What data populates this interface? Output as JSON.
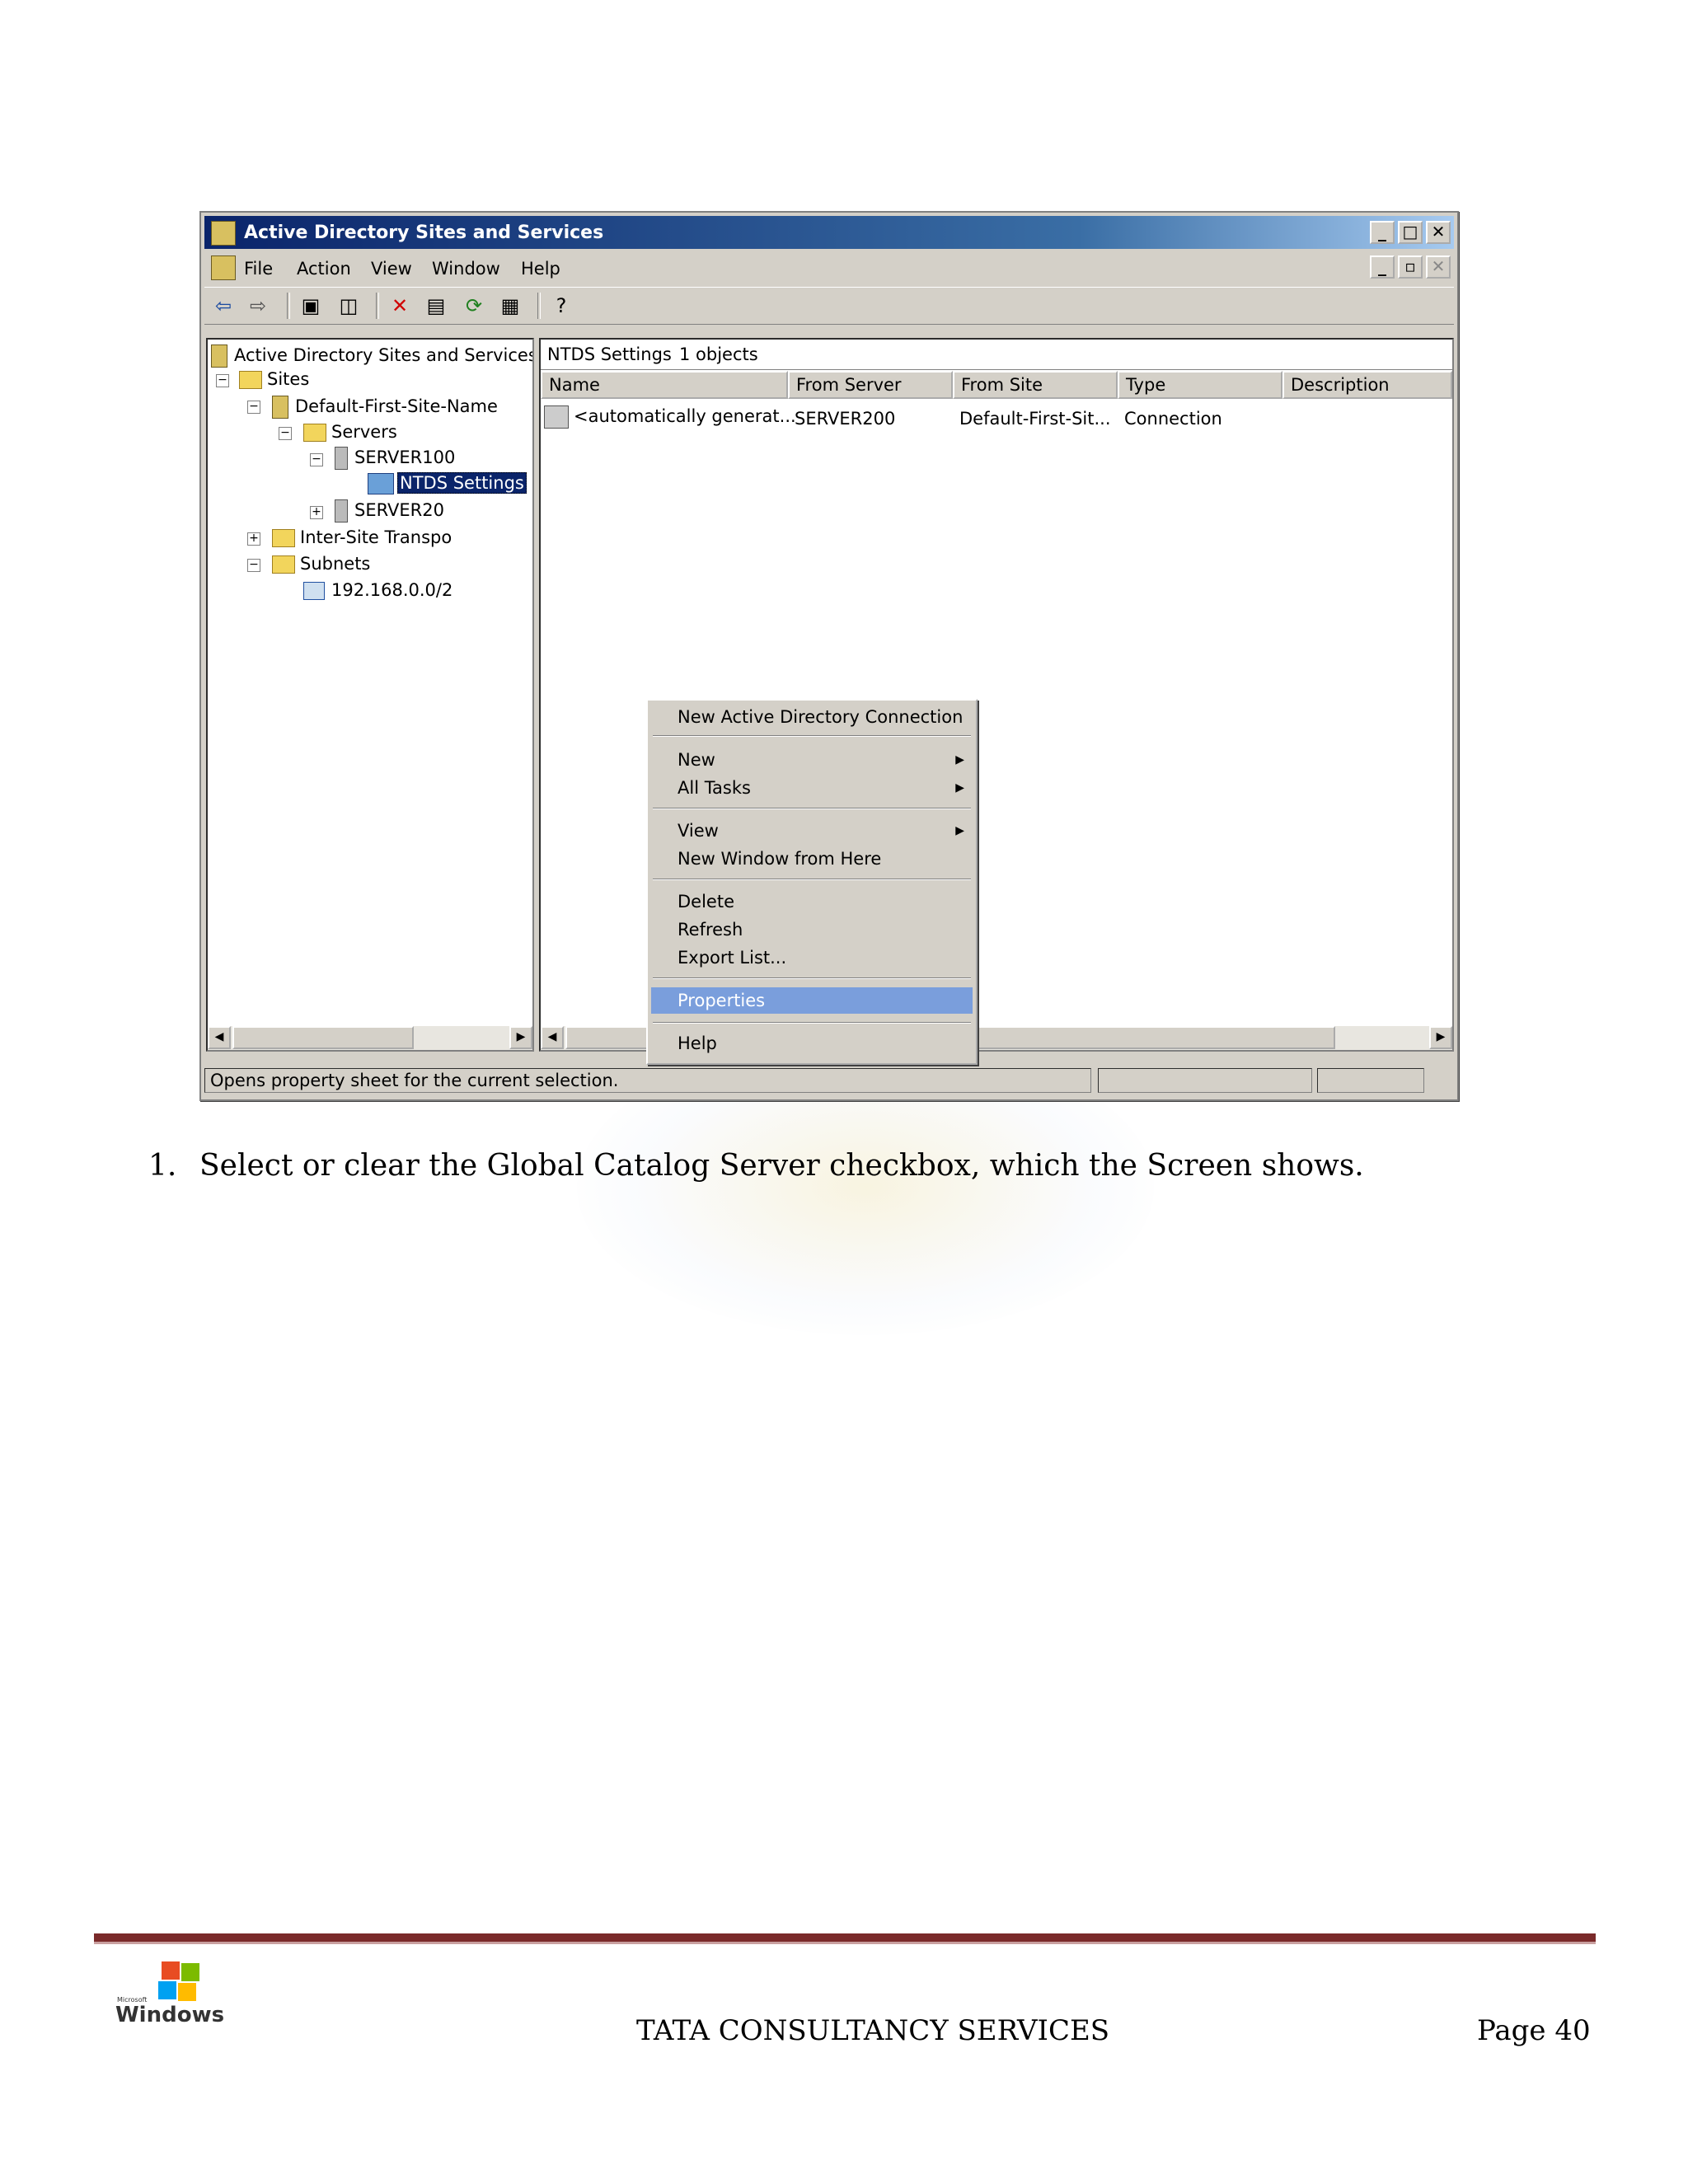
{
  "window": {
    "title": "Active Directory Sites and Services",
    "menu": [
      "File",
      "Action",
      "View",
      "Window",
      "Help"
    ]
  },
  "tree": {
    "root": "Active Directory Sites and Services [s",
    "sites": "Sites",
    "default_site": "Default-First-Site-Name",
    "servers": "Servers",
    "server100": "SERVER100",
    "ntds": "NTDS Settings",
    "server200": "SERVER20",
    "inter_site": "Inter-Site Transpo",
    "subnets": "Subnets",
    "subnet": "192.168.0.0/2"
  },
  "list": {
    "header_title": "NTDS Settings",
    "header_count": "1 objects",
    "columns": [
      "Name",
      "From Server",
      "From Site",
      "Type",
      "Description"
    ],
    "rows": [
      {
        "name": "<automatically generat...",
        "from_server": "SERVER200",
        "from_site": "Default-First-Sit...",
        "type": "Connection",
        "description": ""
      }
    ]
  },
  "context_menu": {
    "new_connection": "New Active Directory Connection",
    "new": "New",
    "all_tasks": "All Tasks",
    "view": "View",
    "new_window": "New Window from Here",
    "delete": "Delete",
    "refresh": "Refresh",
    "export": "Export List...",
    "properties": "Properties",
    "help": "Help"
  },
  "status": "Opens property sheet for the current selection.",
  "document": {
    "step_number": "1.",
    "step_text": "Select or clear the Global Catalog Server checkbox, which the Screen shows.",
    "footer_company": "TATA CONSULTANCY SERVICES",
    "footer_page": "Page 40",
    "logo_text": "Windows",
    "logo_small": "Microsoft"
  }
}
